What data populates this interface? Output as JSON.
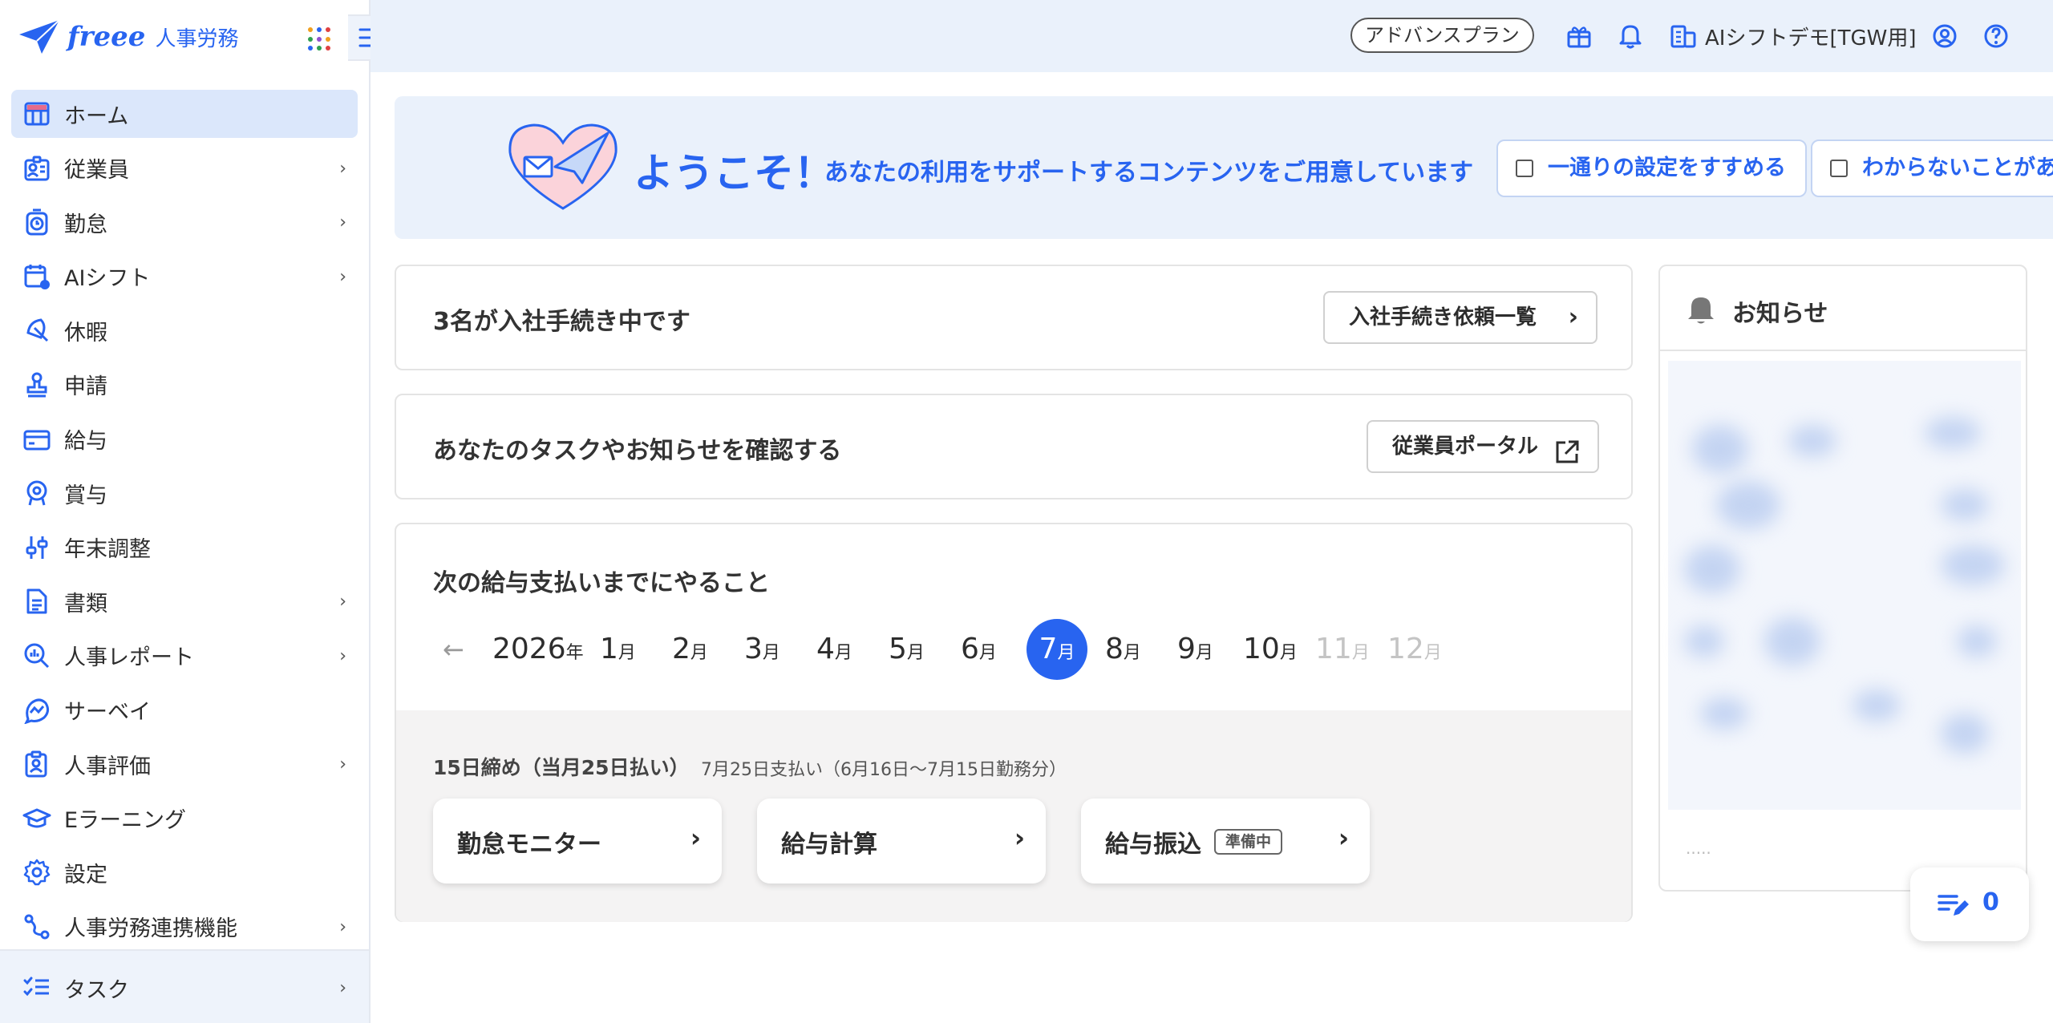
{
  "app": {
    "brand": "freee",
    "product": "人事労務"
  },
  "sidebar": {
    "items": [
      {
        "label": "ホーム",
        "icon": "home-icon",
        "has_chevron": false,
        "active": true
      },
      {
        "label": "従業員",
        "icon": "employee-card-icon",
        "has_chevron": true
      },
      {
        "label": "勤怠",
        "icon": "stopwatch-icon",
        "has_chevron": true
      },
      {
        "label": "AIシフト",
        "icon": "calendar-clock-icon",
        "has_chevron": true
      },
      {
        "label": "休暇",
        "icon": "umbrella-icon",
        "has_chevron": false
      },
      {
        "label": "申請",
        "icon": "stamp-icon",
        "has_chevron": false
      },
      {
        "label": "給与",
        "icon": "credit-card-icon",
        "has_chevron": false
      },
      {
        "label": "賞与",
        "icon": "medal-icon",
        "has_chevron": false
      },
      {
        "label": "年末調整",
        "icon": "sliders-icon",
        "has_chevron": false
      },
      {
        "label": "書類",
        "icon": "document-icon",
        "has_chevron": true
      },
      {
        "label": "人事レポート",
        "icon": "chart-search-icon",
        "has_chevron": true
      },
      {
        "label": "サーベイ",
        "icon": "survey-icon",
        "has_chevron": false
      },
      {
        "label": "人事評価",
        "icon": "clipboard-person-icon",
        "has_chevron": true
      },
      {
        "label": "Eラーニング",
        "icon": "graduation-cap-icon",
        "has_chevron": false
      },
      {
        "label": "設定",
        "icon": "gear-icon",
        "has_chevron": false
      },
      {
        "label": "人事労務連携機能",
        "icon": "connection-icon",
        "has_chevron": true
      }
    ],
    "task": {
      "label": "タスク",
      "icon": "checklist-icon"
    }
  },
  "header": {
    "plan": "アドバンスプラン",
    "company": "AIシフトデモ[TGW用]"
  },
  "welcome": {
    "greeting": "ようこそ！",
    "description": "あなたの利用をサポートするコンテンツをご用意しています",
    "buttons": [
      "一通りの設定をすすめる",
      "わからないことがあ"
    ]
  },
  "onboarding_card": {
    "title": "3名が入社手続き中です",
    "button": "入社手続き依頼一覧"
  },
  "portal_card": {
    "title": "あなたのタスクやお知らせを確認する",
    "button": "従業員ポータル"
  },
  "payroll_card": {
    "title": "次の給与支払いまでにやること",
    "year": "2026",
    "year_unit": "年",
    "month_unit": "月",
    "months": [
      "1",
      "2",
      "3",
      "4",
      "5",
      "6",
      "7",
      "8",
      "9",
      "10",
      "11",
      "12"
    ],
    "selected_month": "7",
    "disabled_months": [
      "11",
      "12"
    ],
    "cutoff": "15日締め（当月25日払い）",
    "range": "7月25日支払い（6月16日〜7月15日勤務分）",
    "steps": [
      {
        "label": "勤怠モニター",
        "badge": ""
      },
      {
        "label": "給与計算",
        "badge": ""
      },
      {
        "label": "給与振込",
        "badge": "準備中"
      }
    ]
  },
  "notice": {
    "title": "お知らせ"
  },
  "task_fab": {
    "count": "0"
  },
  "colors": {
    "accent": "#2864f0",
    "sidebar_active": "#dbe7fb",
    "header_bg": "#eaf1fb"
  }
}
